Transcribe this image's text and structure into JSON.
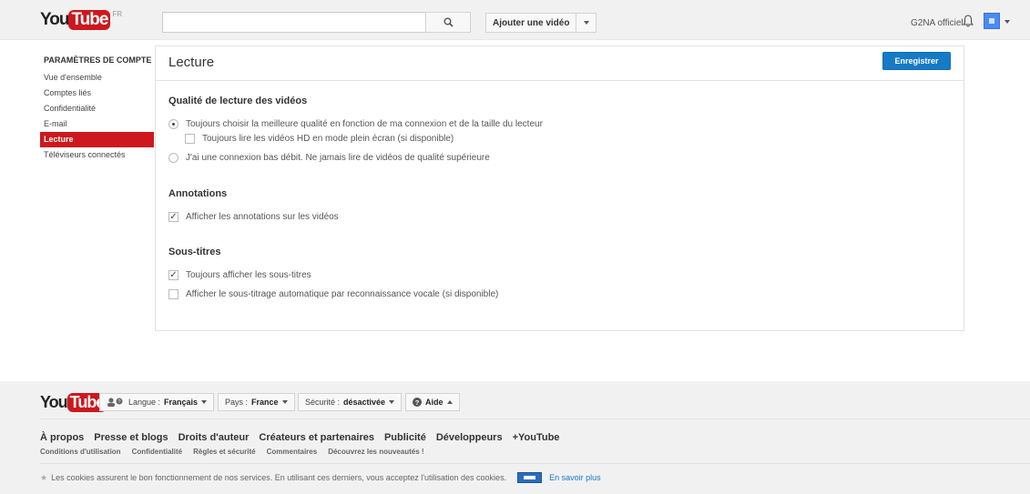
{
  "header": {
    "logo_you": "You",
    "logo_tube": "Tube",
    "logo_country": "FR",
    "search_placeholder": "",
    "upload_label": "Ajouter une vidéo",
    "user_name": "G2NA officiel"
  },
  "sidebar": {
    "heading": "PARAMÈTRES DE COMPTE",
    "items": [
      {
        "label": "Vue d'ensemble"
      },
      {
        "label": "Comptes liés"
      },
      {
        "label": "Confidentialité"
      },
      {
        "label": "E-mail"
      },
      {
        "label": "Lecture"
      },
      {
        "label": "Téléviseurs connectés"
      }
    ]
  },
  "main": {
    "title": "Lecture",
    "save_label": "Enregistrer",
    "quality": {
      "title": "Qualité de lecture des vidéos",
      "best_quality": "Toujours choisir la meilleure qualité en fonction de ma connexion et de la taille du lecteur",
      "hd_fullscreen": "Toujours lire les vidéos HD en mode plein écran (si disponible)",
      "low_bandwidth": "J'ai une connexion bas débit. Ne jamais lire de vidéos de qualité supérieure"
    },
    "annotations": {
      "title": "Annotations",
      "show": "Afficher les annotations sur les vidéos"
    },
    "subtitles": {
      "title": "Sous-titres",
      "always": "Toujours afficher les sous-titres",
      "auto": "Afficher le sous-titrage automatique par reconnaissance vocale (si disponible)"
    }
  },
  "footer": {
    "language_label": "Langue :",
    "language_value": "Français",
    "country_label": "Pays :",
    "country_value": "France",
    "safety_label": "Sécurité :",
    "safety_value": "désactivée",
    "help_label": "Aide",
    "links": [
      "À propos",
      "Presse et blogs",
      "Droits d'auteur",
      "Créateurs et partenaires",
      "Publicité",
      "Développeurs",
      "+YouTube"
    ],
    "sub_links": [
      "Conditions d'utilisation",
      "Confidentialité",
      "Règles et sécurité",
      "Commentaires",
      "Découvrez les nouveautés !"
    ],
    "cookie_text": "Les cookies assurent le bon fonctionnement de nos services. En utilisant ces derniers, vous acceptez l'utilisation des cookies.",
    "learn_more": "En savoir plus"
  }
}
